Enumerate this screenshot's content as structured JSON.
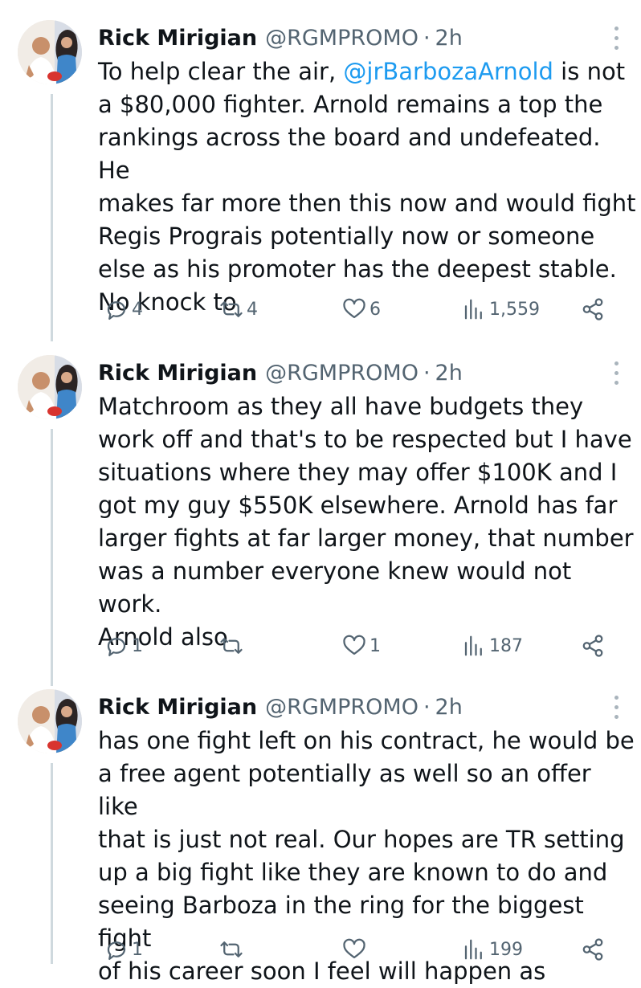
{
  "tweets": [
    {
      "author": "Rick Mirigian",
      "handle": "@RGMPROMO",
      "separator": "·",
      "time": "2h",
      "text_before": "To help clear the air, ",
      "mention": "@jrBarbozaArnold",
      "text_after": " is not\na $80,000 fighter. Arnold remains a top the\nrankings across the board and undefeated. He\nmakes far more then this now and would fight\nRegis Prograis potentially now or someone\nelse as his promoter has the deepest stable.\nNo knock to",
      "replies": "4",
      "reposts": "4",
      "likes": "6",
      "views": "1,559"
    },
    {
      "author": "Rick Mirigian",
      "handle": "@RGMPROMO",
      "separator": "·",
      "time": "2h",
      "text": "Matchroom as they all have budgets they\nwork off and that's to be respected but I have\nsituations where they may offer $100K and I\ngot my guy $550K elsewhere. Arnold has far\nlarger fights at far larger money, that number\nwas a number everyone knew would not work.\nArnold also",
      "replies": "1",
      "reposts": "",
      "likes": "1",
      "views": "187"
    },
    {
      "author": "Rick Mirigian",
      "handle": "@RGMPROMO",
      "separator": "·",
      "time": "2h",
      "text": "has one fight left on his contract, he would be\na free agent potentially as well so an offer like\nthat is just not real. Our hopes are TR setting\nup a big fight like they are known to do and\nseeing Barboza in the ring for the biggest fight\nof his career soon I feel will happen as",
      "replies": "1",
      "reposts": "",
      "likes": "",
      "views": "199"
    }
  ],
  "icons": {
    "reply": "reply-icon",
    "repost": "repost-icon",
    "like": "heart-icon",
    "views": "views-icon",
    "share": "share-icon",
    "more": "more-icon"
  },
  "colors": {
    "text": "#0f1419",
    "secondary": "#536471",
    "mention": "#1d9bf0",
    "thread_line": "#cfd9de"
  }
}
